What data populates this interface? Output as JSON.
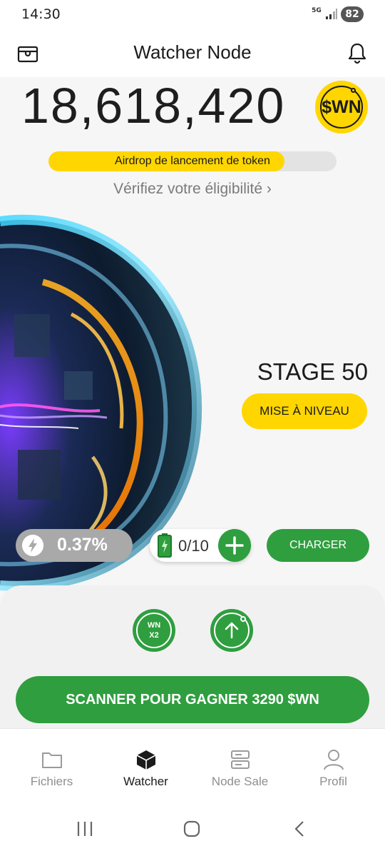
{
  "status_bar": {
    "time": "14:30",
    "network": "5G",
    "battery": "82"
  },
  "header": {
    "title": "Watcher Node",
    "left_icon": "wallet-icon",
    "right_icon": "bell-icon"
  },
  "balance": {
    "value": "18,618,420",
    "token_symbol": "$WN"
  },
  "airdrop": {
    "label": "Airdrop de lancement de token",
    "progress": 0.82,
    "link_text": "Vérifiez votre éligibilité"
  },
  "node": {
    "stage_label": "STAGE 50",
    "upgrade_label": "MISE À NIVEAU"
  },
  "stats": {
    "boost_value": "0.37%",
    "energy_value": "0/10",
    "charge_label": "CHARGER"
  },
  "actions": {
    "multiplier_line1": "WN",
    "multiplier_line2": "X2",
    "scan_label": "SCANNER POUR GAGNER 3290 $WN"
  },
  "nav": {
    "items": [
      {
        "label": "Fichiers",
        "icon": "folder-icon",
        "active": false
      },
      {
        "label": "Watcher",
        "icon": "cube-icon",
        "active": true
      },
      {
        "label": "Node Sale",
        "icon": "server-icon",
        "active": false
      },
      {
        "label": "Profil",
        "icon": "user-icon",
        "active": false
      }
    ]
  },
  "colors": {
    "accent_green": "#2f9e3f",
    "accent_yellow": "#ffd600",
    "background": "#f6f6f6"
  }
}
